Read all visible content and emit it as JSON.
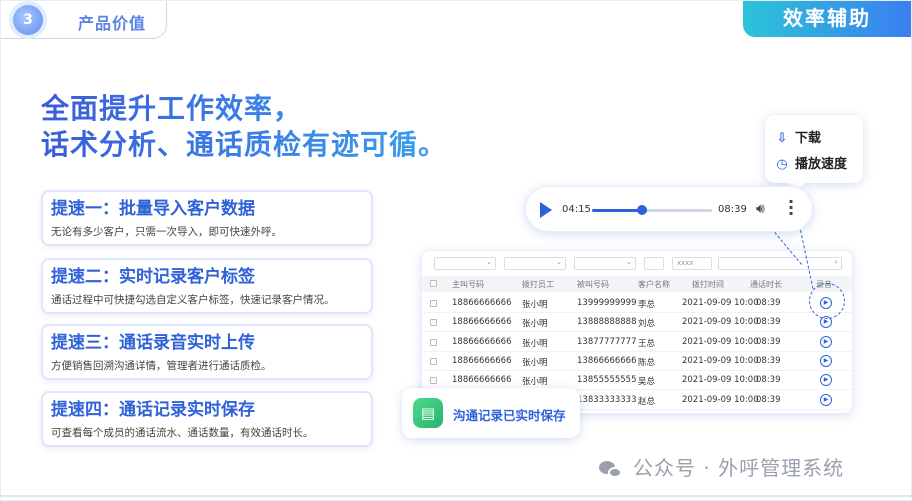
{
  "badge": {
    "number": "3",
    "title": "产品价值"
  },
  "tag": "效率辅助",
  "headline": {
    "line1": "全面提升工作效率，",
    "line2": "话术分析、通话质检有迹可循。"
  },
  "cards": [
    {
      "title": "提速一：批量导入客户数据",
      "desc": "无论有多少客户，只需一次导入，即可快速外呼。"
    },
    {
      "title": "提速二：实时记录客户标签",
      "desc": "通话过程中可快捷勾选自定义客户标签，快速记录客户情况。"
    },
    {
      "title": "提速三：通话录音实时上传",
      "desc": "方便销售回溯沟通详情，管理者进行通话质检。"
    },
    {
      "title": "提速四：通话记录实时保存",
      "desc": "可查看每个成员的通话流水、通话数量，有效通话时长。"
    }
  ],
  "player": {
    "start": "04:15",
    "end": "08:39",
    "progress": 0.42,
    "play_icon": "play-icon",
    "volume_icon": "volume-icon",
    "more_icon": "more-icon"
  },
  "popup": [
    {
      "icon": "download-icon",
      "glyph": "⇩",
      "label": "下载"
    },
    {
      "icon": "clock-icon",
      "glyph": "◷",
      "label": "播放速度"
    }
  ],
  "table": {
    "filter_placeholder": "xxxx",
    "headers": [
      "主叫号码",
      "拨打员工",
      "被叫号码",
      "客户名称",
      "拨打时间",
      "通话时长",
      "录音"
    ],
    "rows": [
      [
        "18866666666",
        "张小明",
        "13999999999",
        "李总",
        "2021-09-09 10:00",
        "08:39"
      ],
      [
        "18866666666",
        "张小明",
        "13888888888",
        "刘总",
        "2021-09-09 10:00",
        "08:39"
      ],
      [
        "18866666666",
        "张小明",
        "13877777777",
        "王总",
        "2021-09-09 10:00",
        "08:39"
      ],
      [
        "18866666666",
        "张小明",
        "13866666666",
        "陈总",
        "2021-09-09 10:00",
        "08:39"
      ],
      [
        "18866666666",
        "张小明",
        "13855555555",
        "吴总",
        "2021-09-09 10:00",
        "08:39"
      ],
      [
        "18866666666",
        "",
        "13833333333",
        "赵总",
        "2021-09-09 10:00",
        "08:39"
      ]
    ]
  },
  "saved_badge": "沟通记录已实时保存",
  "watermark": "公众号 · 外呼管理系统"
}
